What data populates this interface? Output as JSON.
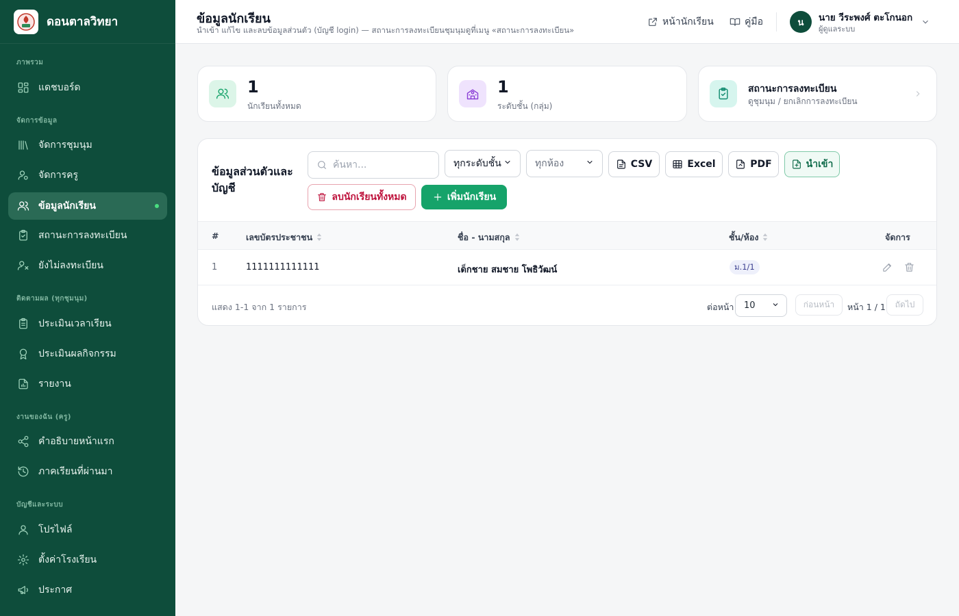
{
  "brand": {
    "name": "ดอนตาลวิทยา"
  },
  "sidebar": {
    "sections": [
      {
        "label": "ภาพรวม"
      },
      {
        "label": "จัดการข้อมูล"
      },
      {
        "label": "ติดตามผล (ทุกชุมนุม)"
      },
      {
        "label": "งานของฉัน (ครู)"
      },
      {
        "label": "บัญชีและระบบ"
      }
    ],
    "items": [
      {
        "label": "แดชบอร์ด",
        "icon": "dashboard-icon"
      },
      {
        "label": "จัดการชุมนุม",
        "icon": "library-icon"
      },
      {
        "label": "จัดการครู",
        "icon": "user-gear-icon"
      },
      {
        "label": "ข้อมูลนักเรียน",
        "icon": "users-icon",
        "active": true
      },
      {
        "label": "สถานะการลงทะเบียน",
        "icon": "clipboard-check-icon"
      },
      {
        "label": "ยังไม่ลงทะเบียน",
        "icon": "user-x-icon"
      },
      {
        "label": "ประเมินเวลาเรียน",
        "icon": "clipboard-list-icon"
      },
      {
        "label": "ประเมินผลกิจกรรม",
        "icon": "award-icon"
      },
      {
        "label": "รายงาน",
        "icon": "report-chart-icon"
      },
      {
        "label": "คำอธิบายหน้าแรก",
        "icon": "share-icon"
      },
      {
        "label": "ภาคเรียนที่ผ่านมา",
        "icon": "history-icon"
      },
      {
        "label": "โปรไฟล์",
        "icon": "user-icon"
      },
      {
        "label": "ตั้งค่าโรงเรียน",
        "icon": "gear-icon"
      },
      {
        "label": "ประกาศ",
        "icon": "megaphone-icon"
      }
    ]
  },
  "header": {
    "title": "ข้อมูลนักเรียน",
    "subtitle": "นำเข้า แก้ไข และลบข้อมูลส่วนตัว (บัญชี login) — สถานะการลงทะเบียนชุมนุมดูที่เมนู «สถานะการลงทะเบียน»",
    "student_page_link": "หน้านักเรียน",
    "manual_link": "คู่มือ",
    "user": {
      "initial": "น",
      "name": "นาย วีระพงศ์ ตะโกนอก",
      "role": "ผู้ดูแลระบบ"
    }
  },
  "stats": {
    "students": {
      "value": "1",
      "label": "นักเรียนทั้งหมด"
    },
    "levels": {
      "value": "1",
      "label": "ระดับชั้น (กลุ่ม)"
    },
    "status": {
      "title": "สถานะการลงทะเบียน",
      "subtitle": "ดูชุมนุม / ยกเลิกการลงทะเบียน"
    }
  },
  "panel": {
    "title": "ข้อมูลส่วนตัวและบัญชี",
    "search_placeholder": "ค้นหา...",
    "level_filter": "ทุกระดับชั้น",
    "room_filter": "ทุกห้อง",
    "csv_label": "CSV",
    "excel_label": "Excel",
    "pdf_label": "PDF",
    "import_label": "นำเข้า",
    "delete_all_label": "ลบนักเรียนทั้งหมด",
    "add_label": "เพิ่มนักเรียน"
  },
  "table": {
    "columns": [
      "#",
      "เลขบัตรประชาชน",
      "ชื่อ - นามสกุล",
      "ชั้น/ห้อง",
      "จัดการ"
    ],
    "rows": [
      {
        "no": "1",
        "national_id": "1111111111111",
        "name": "เด็กชาย สมชาย โพธิวัฒน์",
        "class": "ม.1/1"
      }
    ]
  },
  "pagination": {
    "summary": "แสดง 1-1 จาก 1 รายการ",
    "per_page_label": "ต่อหน้า",
    "per_page": "10",
    "prev": "ก่อนหน้า",
    "page_info": "หน้า 1 / 1",
    "next": "ถัดไป"
  },
  "colors": {
    "sidebar": "#0e4d3b",
    "accent": "#16a36a",
    "danger": "#be123c"
  }
}
